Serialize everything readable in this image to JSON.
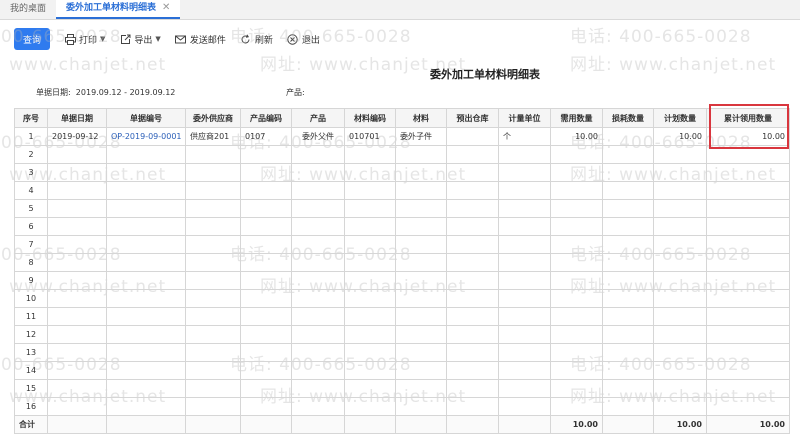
{
  "tabs": [
    {
      "label": "我的桌面"
    },
    {
      "label": "委外加工单材料明细表"
    }
  ],
  "toolbar": {
    "query": "查询",
    "print": "打印",
    "export": "导出",
    "send_mail": "发送邮件",
    "refresh": "刷新",
    "exit": "退出"
  },
  "report": {
    "title": "委外加工单材料明细表",
    "date_label": "单据日期:",
    "date_value": "2019.09.12 - 2019.09.12",
    "product_label": "产品:"
  },
  "table": {
    "headers": [
      "序号",
      "单据日期",
      "单据编号",
      "委外供应商",
      "产品编码",
      "产品",
      "材料编码",
      "材料",
      "预出仓库",
      "计量单位",
      "需用数量",
      "损耗数量",
      "计划数量",
      "累计领用数量"
    ],
    "rows": [
      [
        "1",
        "2019-09-12",
        "OP-2019-09-0001",
        "供应商201",
        "0107",
        "委外父件",
        "010701",
        "委外子件",
        "",
        "个",
        "10.00",
        "",
        "10.00",
        "10.00"
      ],
      [
        "2",
        "",
        "",
        "",
        "",
        "",
        "",
        "",
        "",
        "",
        "",
        "",
        "",
        ""
      ],
      [
        "3",
        "",
        "",
        "",
        "",
        "",
        "",
        "",
        "",
        "",
        "",
        "",
        "",
        ""
      ],
      [
        "4",
        "",
        "",
        "",
        "",
        "",
        "",
        "",
        "",
        "",
        "",
        "",
        "",
        ""
      ],
      [
        "5",
        "",
        "",
        "",
        "",
        "",
        "",
        "",
        "",
        "",
        "",
        "",
        "",
        ""
      ],
      [
        "6",
        "",
        "",
        "",
        "",
        "",
        "",
        "",
        "",
        "",
        "",
        "",
        "",
        ""
      ],
      [
        "7",
        "",
        "",
        "",
        "",
        "",
        "",
        "",
        "",
        "",
        "",
        "",
        "",
        ""
      ],
      [
        "8",
        "",
        "",
        "",
        "",
        "",
        "",
        "",
        "",
        "",
        "",
        "",
        "",
        ""
      ],
      [
        "9",
        "",
        "",
        "",
        "",
        "",
        "",
        "",
        "",
        "",
        "",
        "",
        "",
        ""
      ],
      [
        "10",
        "",
        "",
        "",
        "",
        "",
        "",
        "",
        "",
        "",
        "",
        "",
        "",
        ""
      ],
      [
        "11",
        "",
        "",
        "",
        "",
        "",
        "",
        "",
        "",
        "",
        "",
        "",
        "",
        ""
      ],
      [
        "12",
        "",
        "",
        "",
        "",
        "",
        "",
        "",
        "",
        "",
        "",
        "",
        "",
        ""
      ],
      [
        "13",
        "",
        "",
        "",
        "",
        "",
        "",
        "",
        "",
        "",
        "",
        "",
        "",
        ""
      ],
      [
        "14",
        "",
        "",
        "",
        "",
        "",
        "",
        "",
        "",
        "",
        "",
        "",
        "",
        ""
      ],
      [
        "15",
        "",
        "",
        "",
        "",
        "",
        "",
        "",
        "",
        "",
        "",
        "",
        "",
        ""
      ],
      [
        "16",
        "",
        "",
        "",
        "",
        "",
        "",
        "",
        "",
        "",
        "",
        "",
        "",
        ""
      ]
    ],
    "total": [
      "合计",
      "",
      "",
      "",
      "",
      "",
      "",
      "",
      "",
      "",
      "10.00",
      "",
      "10.00",
      "10.00"
    ]
  },
  "watermark": {
    "phone": "电话: 400-665-0028",
    "site": "网址: www.chanjet.net"
  },
  "colors": {
    "accent": "#2f7bef",
    "highlight": "#d9363e"
  }
}
